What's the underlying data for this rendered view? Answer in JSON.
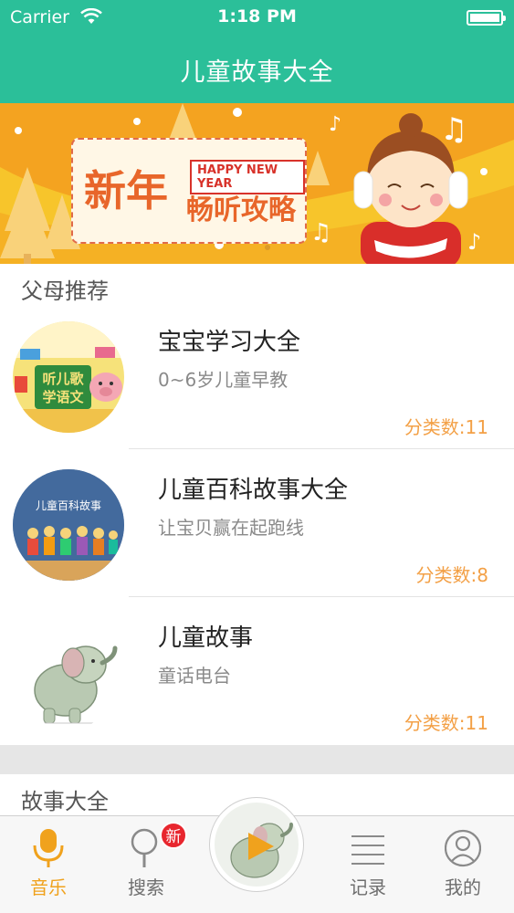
{
  "status_bar": {
    "carrier": "Carrier",
    "time": "1:18 PM"
  },
  "nav": {
    "title": "儿童故事大全"
  },
  "banner": {
    "main_text": "新年",
    "tag_text": "HAPPY NEW YEAR",
    "sub_text": "畅听攻略"
  },
  "sections": [
    {
      "title": "父母推荐"
    },
    {
      "title": "故事大全"
    }
  ],
  "items": [
    {
      "title": "宝宝学习大全",
      "subtitle": "0~6岁儿童早教",
      "count": "分类数:11",
      "thumb_text": "听儿歌学语文"
    },
    {
      "title": "儿童百科故事大全",
      "subtitle": "让宝贝赢在起跑线",
      "count": "分类数:8",
      "thumb_text": "儿童百科故事"
    },
    {
      "title": "儿童故事",
      "subtitle": "童话电台",
      "count": "分类数:11"
    }
  ],
  "tabbar": {
    "tabs": [
      {
        "label": "音乐",
        "icon": "microphone-icon",
        "active": true
      },
      {
        "label": "搜索",
        "icon": "search-icon",
        "badge": "新"
      },
      {
        "label": "",
        "icon": "play-icon"
      },
      {
        "label": "记录",
        "icon": "list-icon"
      },
      {
        "label": "我的",
        "icon": "user-icon"
      }
    ]
  },
  "colors": {
    "primary": "#2bbf99",
    "accent": "#f0a21d",
    "count": "#f3a046",
    "badge": "#e8262e",
    "banner": "#f4a320"
  }
}
